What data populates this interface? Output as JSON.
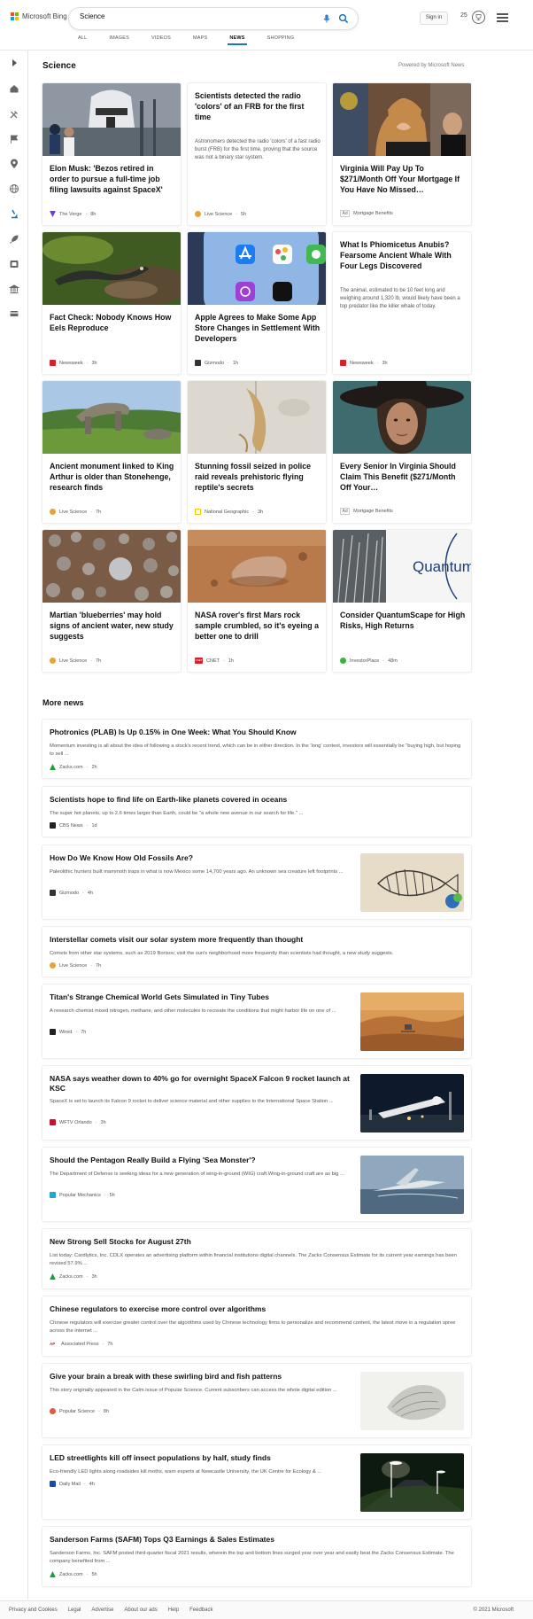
{
  "header": {
    "logo_text": "Microsoft Bing",
    "search_value": "Science",
    "signin_label": "Sign in",
    "points": "25"
  },
  "nav": [
    "ALL",
    "IMAGES",
    "VIDEOS",
    "MAPS",
    "NEWS",
    "SHOPPING"
  ],
  "nav_active": "NEWS",
  "section": {
    "title": "Science",
    "powered": "Powered by Microsoft News"
  },
  "cards": [
    {
      "title": "Elon Musk: 'Bezos retired in order to pursue a full-time job filing lawsuits against SpaceX'",
      "source": "The Verge",
      "time": "8h",
      "icon_color": "#6b3fd3"
    },
    {
      "title": "Scientists detected the radio 'colors' of an FRB for the first time",
      "desc": "Astronomers detected the radio 'colors' of a fast radio burst (FRB) for the first time, proving that the source was not a binary star system.",
      "source": "Live Science",
      "time": "5h",
      "icon_color": "#e8a23a"
    },
    {
      "title": "Virginia Will Pay Up To $271/Month Off Your Mortgage If You Have No Missed…",
      "ad": "Ad",
      "source": "Mortgage Benefits"
    },
    {
      "title": "Fact Check: Nobody Knows How Eels Reproduce",
      "source": "Newsweek",
      "time": "3h",
      "icon_color": "#d4212b"
    },
    {
      "title": "Apple Agrees to Make Some App Store Changes in Settlement With Developers",
      "source": "Gizmodo",
      "time": "1h",
      "icon_color": "#333333"
    },
    {
      "title": "What Is Phiomicetus Anubis? Fearsome Ancient Whale With Four Legs Discovered",
      "desc": "The animal, estimated to be 10 feet long and weighing around 1,320 lb, would likely have been a top predator like the killer whale of today.",
      "source": "Newsweek",
      "time": "3h",
      "icon_color": "#d4212b"
    },
    {
      "title": "Ancient monument linked to King Arthur is older than Stonehenge, research finds",
      "source": "Live Science",
      "time": "7h",
      "icon_color": "#e8a23a"
    },
    {
      "title": "Stunning fossil seized in police raid reveals prehistoric flying reptile's secrets",
      "source": "National Geographic",
      "time": "3h",
      "icon_color": "#f5c400"
    },
    {
      "title": "Every Senior In Virginia Should Claim This Benefit ($271/Month Off Your…",
      "ad": "Ad",
      "source": "Mortgage Benefits"
    },
    {
      "title": "Martian 'blueberries' may hold signs of ancient water, new study suggests",
      "source": "Live Science",
      "time": "7h",
      "icon_color": "#e8a23a"
    },
    {
      "title": "NASA rover's first Mars rock sample crumbled, so it's eyeing a better one to drill",
      "source": "CNET",
      "time": "1h",
      "icon_color": "#d4212b",
      "icon_text": "CNET"
    },
    {
      "title": "Consider QuantumScape for High Risks, High Returns",
      "source": "InvestorPlace",
      "time": "48m",
      "icon_color": "#3cb043",
      "img_text": "Quantum"
    }
  ],
  "more_news": {
    "title": "More news",
    "items": [
      {
        "title": "Photronics (PLAB) Is Up 0.15% in One Week: What You Should Know",
        "desc": "Momentum investing is all about the idea of following a stock's recent trend, which can be in either direction. In the 'long' context, investors will essentially be \"buying high, but hoping to sell ...",
        "source": "Zacks.com",
        "time": "2h",
        "icon_color": "#1da03a"
      },
      {
        "title": "Scientists hope to find life on Earth-like planets covered in oceans",
        "desc": "The super hot planets, up to 2.6 times larger than Earth, could be \"a whole new avenue in our search for life.\" ...",
        "source": "CBS News",
        "time": "1d",
        "icon_color": "#222222"
      },
      {
        "title": "How Do We Know How Old Fossils Are?",
        "desc": "Paleolithic hunters built mammoth traps in what is now Mexico some 14,700 years ago. An unknown sea creature left footprints ...",
        "source": "Gizmodo",
        "time": "4h",
        "icon_color": "#333333"
      },
      {
        "title": "Interstellar comets visit our solar system more frequently than thought",
        "desc": "Comets from other star systems, such as 2019 Borisov, visit the sun's neighborhood more frequently than scientists had thought, a new study suggests.",
        "source": "Live Science",
        "time": "7h",
        "icon_color": "#e8a23a"
      },
      {
        "title": "Titan's Strange Chemical World Gets Simulated in Tiny Tubes",
        "desc": "A research chemist mixed nitrogen, methane, and other molecules to recreate the conditions that might harbor life on one of ...",
        "source": "Wired",
        "time": "7h",
        "icon_color": "#222222"
      },
      {
        "title": "NASA says weather down to 40% go for overnight SpaceX Falcon 9 rocket launch at KSC",
        "desc": "SpaceX is set to launch its Falcon 9 rocket to deliver science material and other supplies to the International Space Station ...",
        "source": "WFTV Orlando",
        "time": "3h",
        "icon_color": "#c8102e"
      },
      {
        "title": "Should the Pentagon Really Build a Flying 'Sea Monster'?",
        "desc": "The Department of Defense is seeking ideas for a new generation of wing-in-ground (WIG) craft.Wing-in-ground craft are as big ...",
        "source": "Popular Mechanics",
        "time": "5h",
        "icon_color": "#20a5d8"
      },
      {
        "title": "New Strong Sell Stocks for August 27th",
        "desc": "List today: Cardlytics, Inc. CDLX operates an advertising platform within financial institutions digital channels. The Zacks Consensus Estimate for its current year earnings has been revised 57.9% ...",
        "source": "Zacks.com",
        "time": "3h",
        "icon_color": "#1da03a"
      },
      {
        "title": "Chinese regulators to exercise more control over algorithms",
        "desc": "Chinese regulators will exercise greater control over the algorithms used by Chinese technology firms to personalize and recommend content, the latest move in a regulation spree across the internet ...",
        "source": "Associated Press",
        "time": "7h",
        "icon_color": "#d4212b",
        "icon_text": "AP"
      },
      {
        "title": "Give your brain a break with these swirling bird and fish patterns",
        "desc": "This story originally appeared in the Calm issue of Popular Science. Current subscribers can access the whole digital edition ...",
        "source": "Popular Science",
        "time": "8h",
        "icon_color": "#e4573d"
      },
      {
        "title": "LED streetlights kill off insect populations by half, study finds",
        "desc": "Eco-friendly LED lights along roadsides kill moths, warn experts at Newcastle University, the UK Centre for Ecology & ...",
        "source": "Daily Mail",
        "time": "4h",
        "icon_color": "#1d4aa8"
      },
      {
        "title": "Sanderson Farms (SAFM) Tops Q3 Earnings & Sales Estimates",
        "desc": "Sanderson Farms, Inc. SAFM posted third-quarter fiscal 2021 results, wherein the top and bottom lines surged year over year and easily beat the Zacks Consensus Estimate. The company benefited from ...",
        "source": "Zacks.com",
        "time": "5h",
        "icon_color": "#1da03a"
      }
    ]
  },
  "footer": {
    "links": [
      "Privacy and Cookies",
      "Legal",
      "Advertise",
      "About our ads",
      "Help",
      "Feedback"
    ],
    "copyright": "© 2021 Microsoft"
  }
}
